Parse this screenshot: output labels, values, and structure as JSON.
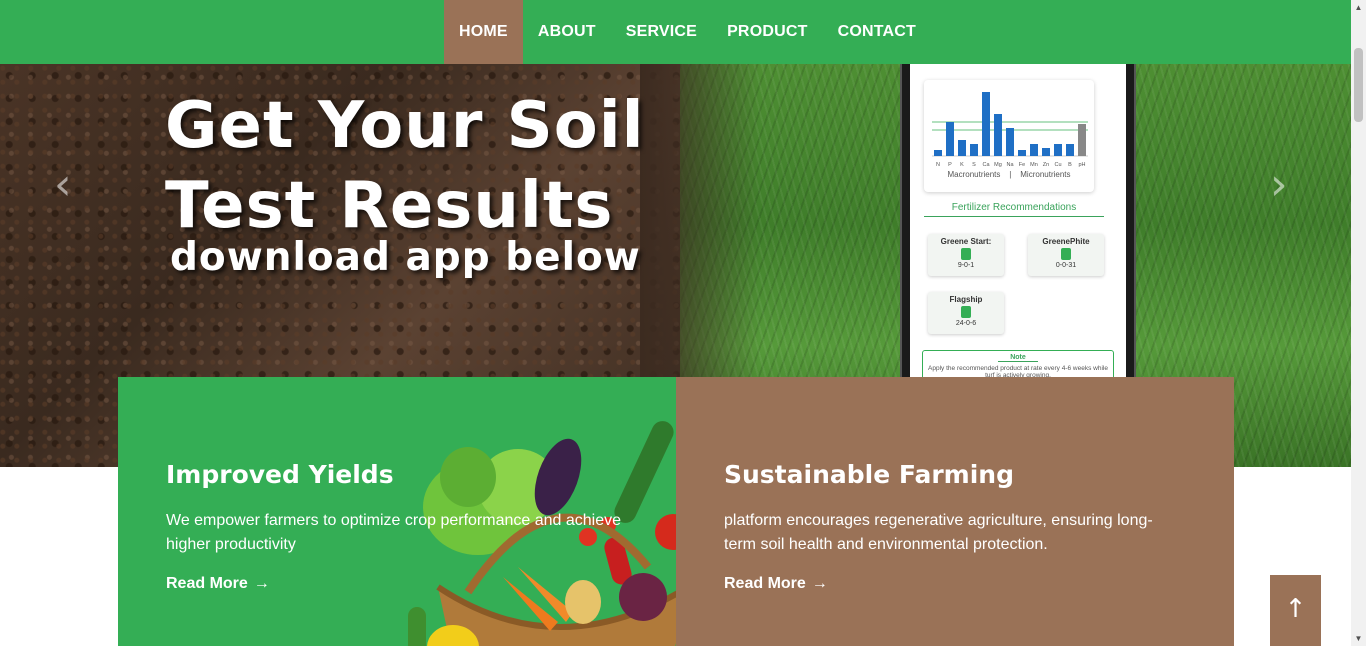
{
  "nav": {
    "items": [
      {
        "label": "HOME",
        "active": true
      },
      {
        "label": "ABOUT"
      },
      {
        "label": "SERVICE"
      },
      {
        "label": "PRODUCT"
      },
      {
        "label": "CONTACT"
      }
    ]
  },
  "hero": {
    "title_line1": "Get Your Soil",
    "title_line2": "Test Results",
    "subtitle": "download app below",
    "prev_icon": "chevron-left-icon",
    "next_icon": "chevron-right-icon",
    "phone": {
      "chart_labels": [
        "N",
        "P",
        "K",
        "S",
        "Ca",
        "Mg",
        "Na",
        "Fe",
        "Mn",
        "Zn",
        "Cu",
        "B",
        "pH"
      ],
      "chart_caption_left": "Macronutrients",
      "chart_caption_sep": "|",
      "chart_caption_right": "Micronutrients",
      "recommendations_title": "Fertilizer Recommendations",
      "products": [
        {
          "name": "Greene Start:",
          "npk": "9-0-1"
        },
        {
          "name": "GreenePhite",
          "npk": "0-0-31"
        },
        {
          "name": "Flagship",
          "npk": "24-0-6"
        }
      ],
      "note_title": "Note",
      "note_text": "Apply the recommended product at rate every 4-6 weeks while turf is actively growing."
    }
  },
  "cards": [
    {
      "title": "Improved Yields",
      "text": "We empower farmers to optimize crop performance and achieve higher productivity",
      "link": "Read More",
      "color": "#34ae55"
    },
    {
      "title": "Sustainable Farming",
      "text": "platform encourages regenerative agriculture, ensuring long-term soil health and environmental protection.",
      "link": "Read More",
      "color": "#9a7257"
    }
  ],
  "back_to_top_icon": "arrow-up-icon",
  "colors": {
    "green": "#34ae55",
    "brown": "#9a7257"
  }
}
